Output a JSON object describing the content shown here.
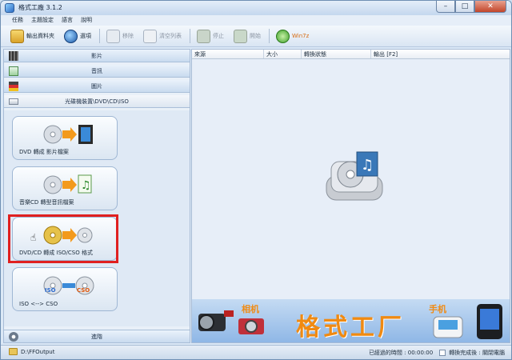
{
  "window": {
    "title": "格式工廠 3.1.2",
    "min": "–",
    "max": "□",
    "close": "✕"
  },
  "menu": [
    "任務",
    "主題設定",
    "語言",
    "說明"
  ],
  "toolbar": {
    "output_folder": "輸出資料夾",
    "options": "選項",
    "remove": "移除",
    "clear_list": "清空列表",
    "stop": "停止",
    "start": "開始",
    "win7z": "Win7z"
  },
  "categories": {
    "video": "影片",
    "audio": "音訊",
    "image": "圖片",
    "rom": "光碟機裝置\\DVD\\CD\\ISO",
    "advanced": "進階"
  },
  "tasks": [
    {
      "label": "DVD 轉成 影片檔案"
    },
    {
      "label": "音樂CD 轉型音訊檔案"
    },
    {
      "label": "DVD/CD 轉成 ISO/CSO 格式"
    },
    {
      "label": "ISO <--> CSO"
    }
  ],
  "task_badges": {
    "iso": "ISO",
    "cso": "CSO"
  },
  "list": {
    "columns": [
      "來源",
      "大小",
      "轉換狀態",
      "輸出 [F2]"
    ]
  },
  "banner": {
    "title": "格式工厂",
    "camera_label": "相机",
    "phone_label": "手机"
  },
  "status": {
    "output_path": "D:\\FFOutput",
    "elapsed": "已經過的時間 : 00:00:00",
    "after_convert": "轉換完成後 : 關閉電腦"
  },
  "colors": {
    "accent": "#f08a12",
    "highlight": "#e02020"
  }
}
